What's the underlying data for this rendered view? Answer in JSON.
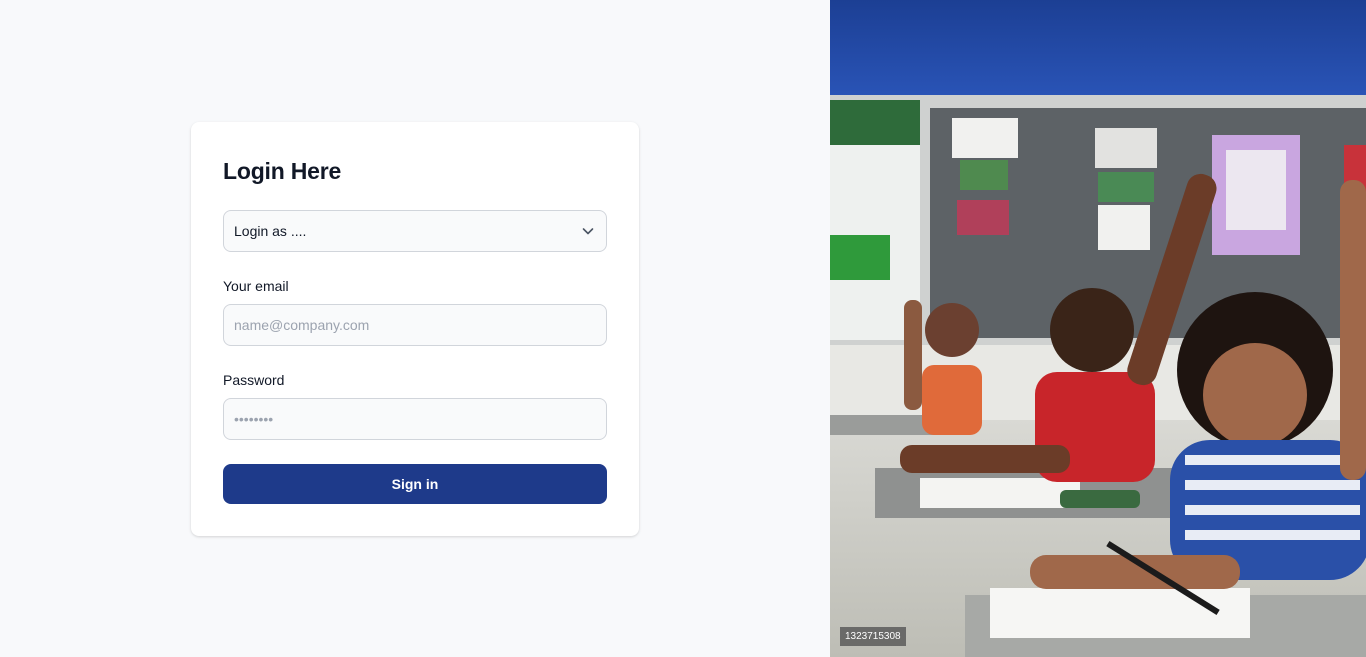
{
  "login": {
    "title": "Login Here",
    "role_select": {
      "selected": "Login as ...."
    },
    "email": {
      "label": "Your email",
      "placeholder": "name@company.com"
    },
    "password": {
      "label": "Password",
      "placeholder": "••••••••"
    },
    "submit_label": "Sign in"
  },
  "hero": {
    "description": "Classroom with students raising hands",
    "image_id": "1323715308"
  },
  "colors": {
    "page_bg": "#f8f9fb",
    "card_bg": "#ffffff",
    "primary": "#1e3a8a",
    "input_bg": "#f9fafb",
    "input_border": "#d1d5db"
  },
  "icons": {
    "select_arrow": "chevron-down-icon"
  }
}
